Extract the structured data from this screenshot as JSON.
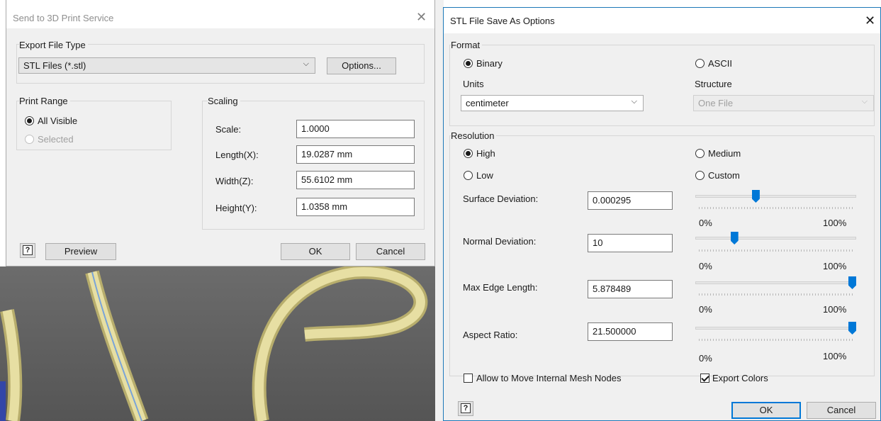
{
  "left_dialog": {
    "title": "Send to 3D Print Service",
    "export_group": {
      "label": "Export File Type",
      "file_type": "STL Files (*.stl)",
      "options_button": "Options..."
    },
    "print_range": {
      "label": "Print Range",
      "all_visible": "All Visible",
      "selected": "Selected",
      "selected_value": "All Visible"
    },
    "scaling": {
      "label": "Scaling",
      "scale_label": "Scale:",
      "scale_value": "1.0000",
      "length_label": "Length(X):",
      "length_value": "19.0287 mm",
      "width_label": "Width(Z):",
      "width_value": "55.6102 mm",
      "height_label": "Height(Y):",
      "height_value": "1.0358 mm"
    },
    "footer": {
      "help_glyph": "?",
      "preview_button": "Preview",
      "ok_button": "OK",
      "cancel_button": "Cancel"
    }
  },
  "right_dialog": {
    "title": "STL File Save As Options",
    "format": {
      "label": "Format",
      "binary": "Binary",
      "ascii": "ASCII",
      "selected": "Binary",
      "units_label": "Units",
      "units_value": "centimeter",
      "structure_label": "Structure",
      "structure_value": "One File"
    },
    "resolution": {
      "label": "Resolution",
      "high": "High",
      "medium": "Medium",
      "low": "Low",
      "custom": "Custom",
      "selected": "High",
      "fields": [
        {
          "label": "Surface Deviation:",
          "value": "0.000295",
          "slider_fraction": 0.37
        },
        {
          "label": "Normal Deviation:",
          "value": "10",
          "slider_fraction": 0.23
        },
        {
          "label": "Max Edge Length:",
          "value": "5.878489",
          "slider_fraction": 1.0
        },
        {
          "label": "Aspect Ratio:",
          "value": "21.500000",
          "slider_fraction": 1.0
        }
      ],
      "slider_min_label": "0%",
      "slider_max_label": "100%"
    },
    "allow_move_nodes": {
      "label": "Allow to Move Internal Mesh Nodes",
      "checked": false
    },
    "export_colors": {
      "label": "Export Colors",
      "checked": true
    },
    "footer": {
      "help_glyph": "?",
      "ok_button": "OK",
      "cancel_button": "Cancel"
    }
  },
  "colors": {
    "accent": "#0078d7",
    "dialog_bg": "#f0f0f0",
    "viewport_bg": "#606060",
    "tube": "#e7dfa3"
  },
  "icons": {
    "close": "close-icon",
    "dropdown": "chevron-down-icon",
    "help": "help-icon"
  }
}
